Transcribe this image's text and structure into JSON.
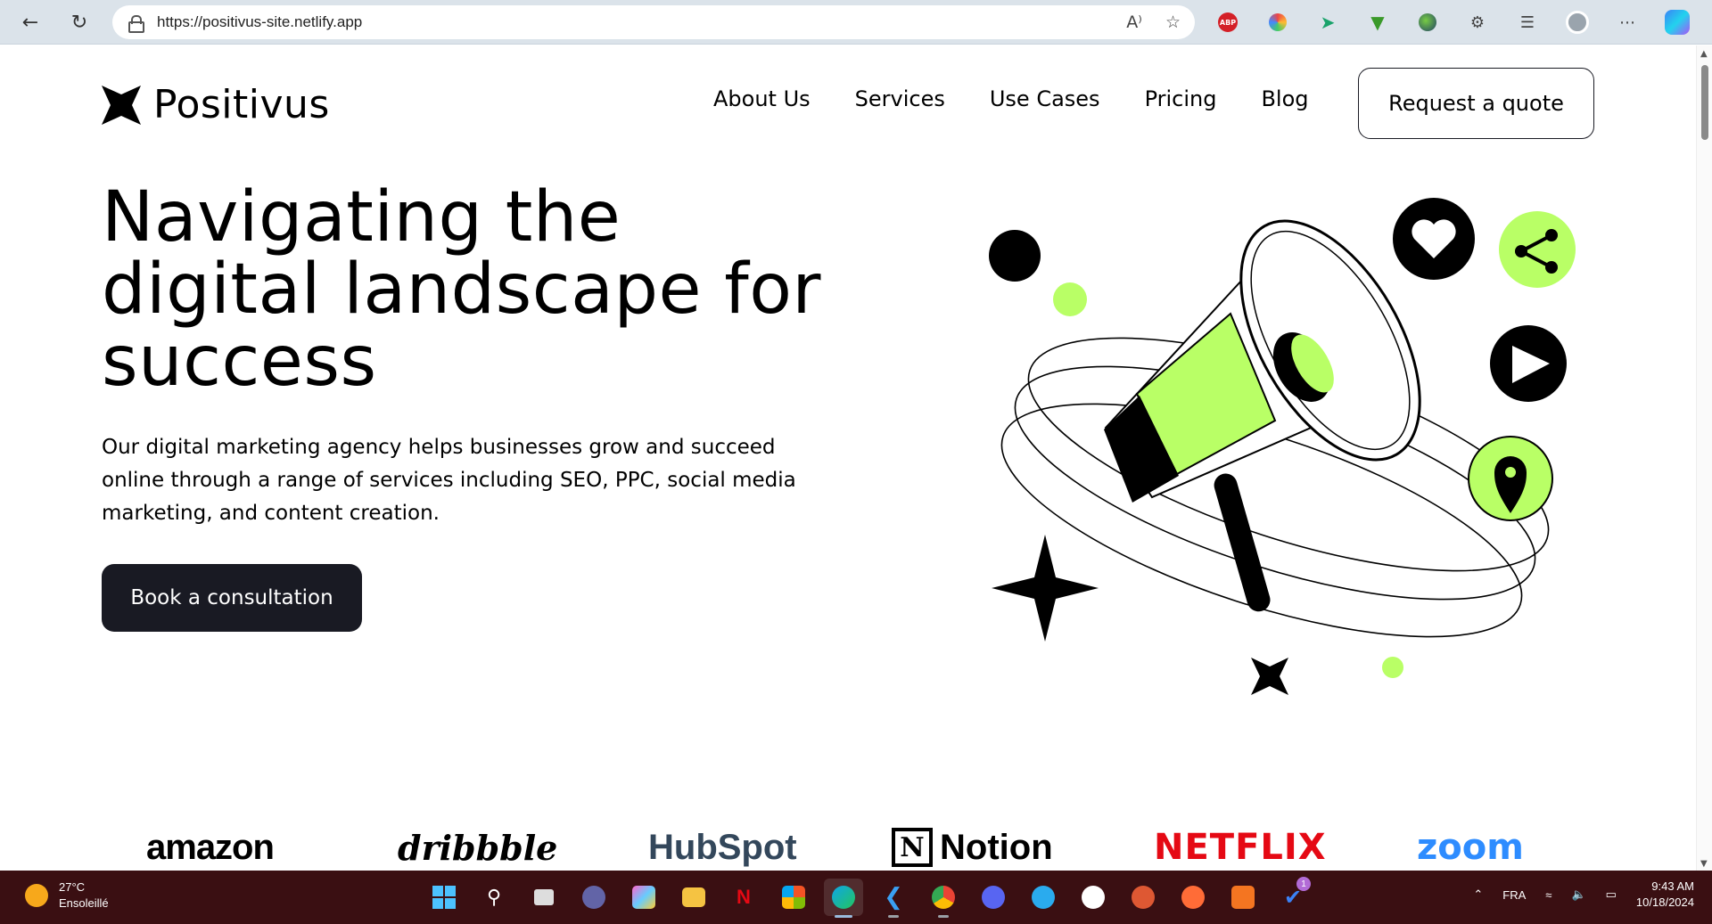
{
  "browser": {
    "url": "https://positivus-site.netlify.app",
    "read_aloud_label": "A⁾",
    "extensions": [
      "ABP"
    ]
  },
  "site": {
    "logo_text": "Positivus",
    "nav": [
      "About Us",
      "Services",
      "Use Cases",
      "Pricing",
      "Blog"
    ],
    "quote_button": "Request a quote"
  },
  "hero": {
    "title": "Navigating the digital landscape for success",
    "text": "Our digital marketing agency helps businesses grow and succeed online through a range of services including SEO, PPC, social media marketing, and content creation.",
    "cta": "Book a consultation"
  },
  "brands": {
    "amazon": "amazon",
    "dribbble": "dribbble",
    "hubspot": "HubSpot",
    "notion": "Notion",
    "notion_mark": "N",
    "netflix": "NETFLIX",
    "zoom": "zoom"
  },
  "taskbar": {
    "temperature": "27°C",
    "weather": "Ensoleillé",
    "badge_count": "1",
    "language": "FRA",
    "time": "9:43 AM",
    "date": "10/18/2024"
  },
  "colors": {
    "accent_green": "#b9ff66",
    "dark": "#191a23",
    "netflix_red": "#e50914",
    "zoom_blue": "#2d8cff",
    "taskbar": "#3a0f12"
  }
}
